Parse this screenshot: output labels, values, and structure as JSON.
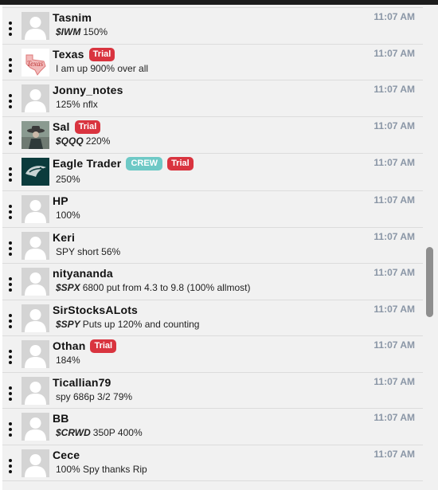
{
  "partial_top_text": "...",
  "messages": [
    {
      "name": "Tasnim",
      "badges": [],
      "ticker": "$IWM",
      "text": "150%",
      "time": "11:07 AM",
      "avatar": "default-avatar"
    },
    {
      "name": "Texas",
      "badges": [
        "Trial"
      ],
      "ticker": "",
      "text": "I am up 900% over all",
      "time": "11:07 AM",
      "avatar": "texas-avatar"
    },
    {
      "name": "Jonny_notes",
      "badges": [],
      "ticker": "",
      "text": "125% nflx",
      "time": "11:07 AM",
      "avatar": "default-avatar"
    },
    {
      "name": "Sal",
      "badges": [
        "Trial"
      ],
      "ticker": "$QQQ",
      "text": "220%",
      "time": "11:07 AM",
      "avatar": "cowboy-avatar"
    },
    {
      "name": "Eagle Trader",
      "badges": [
        "CREW",
        "Trial"
      ],
      "ticker": "",
      "text": "250%",
      "time": "11:07 AM",
      "avatar": "eagles-avatar"
    },
    {
      "name": "HP",
      "badges": [],
      "ticker": "",
      "text": "100%",
      "time": "11:07 AM",
      "avatar": "default-avatar"
    },
    {
      "name": "Keri",
      "badges": [],
      "ticker": "",
      "text": "SPY short 56%",
      "time": "11:07 AM",
      "avatar": "default-avatar"
    },
    {
      "name": "nityananda",
      "badges": [],
      "ticker": "$SPX",
      "text": "6800 put from 4.3 to 9.8 (100% allmost)",
      "time": "11:07 AM",
      "avatar": "default-avatar"
    },
    {
      "name": "SirStocksALots",
      "badges": [],
      "ticker": "$SPY",
      "text": "Puts up 120% and counting",
      "time": "11:07 AM",
      "avatar": "default-avatar"
    },
    {
      "name": "Othan",
      "badges": [
        "Trial"
      ],
      "ticker": "",
      "text": "184%",
      "time": "11:07 AM",
      "avatar": "default-avatar"
    },
    {
      "name": "Ticallian79",
      "badges": [],
      "ticker": "",
      "text": "spy 686p 3/2 79%",
      "time": "11:07 AM",
      "avatar": "default-avatar"
    },
    {
      "name": "BB",
      "badges": [],
      "ticker": "$CRWD",
      "text": "350P 400%",
      "time": "11:07 AM",
      "avatar": "default-avatar"
    },
    {
      "name": "Cece",
      "badges": [],
      "ticker": "",
      "text": "100% Spy thanks Rip",
      "time": "11:07 AM",
      "avatar": "default-avatar"
    }
  ],
  "colors": {
    "trial_badge": "#d9343f",
    "crew_badge": "#6ec9c6",
    "timestamp": "#8a96a6",
    "row_background": "#f1f1f1"
  }
}
